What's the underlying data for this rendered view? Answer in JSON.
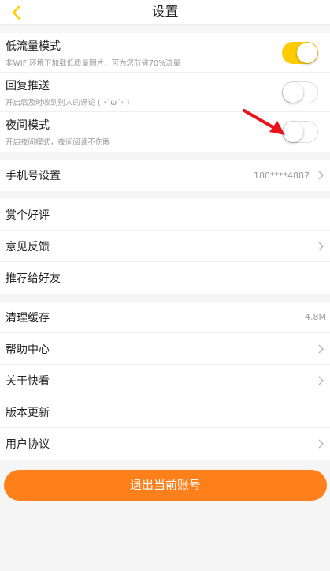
{
  "header": {
    "title": "设置"
  },
  "settings_group": {
    "items": [
      {
        "label": "低流量模式",
        "sub": "非WIFI环境下加载低质量图片，可为您节省70%流量",
        "toggle": "on"
      },
      {
        "label": "回复推送",
        "sub": "开启后及时收到别人的评论 ( ･`ω´･ )",
        "toggle": "off"
      },
      {
        "label": "夜间模式",
        "sub": "开启夜间模式，夜间阅读不伤眼",
        "toggle": "off"
      }
    ]
  },
  "phone": {
    "label": "手机号设置",
    "value": "180****4887"
  },
  "social_group": {
    "items": [
      {
        "label": "赏个好评"
      },
      {
        "label": "意见反馈"
      },
      {
        "label": "推荐给好友"
      }
    ]
  },
  "misc_group": {
    "items": [
      {
        "label": "清理缓存",
        "value": "4.8M"
      },
      {
        "label": "帮助中心"
      },
      {
        "label": "关于快看"
      },
      {
        "label": "版本更新"
      },
      {
        "label": "用户协议"
      }
    ]
  },
  "logout": {
    "label": "退出当前账号"
  },
  "colors": {
    "accent": "#ffcc00",
    "logout": "#ff7f1a",
    "annotation_arrow": "#e8141b"
  },
  "icons": {
    "back": "back-chevron-icon",
    "chevron": "chevron-right-icon",
    "annotation": "red-arrow-icon"
  }
}
